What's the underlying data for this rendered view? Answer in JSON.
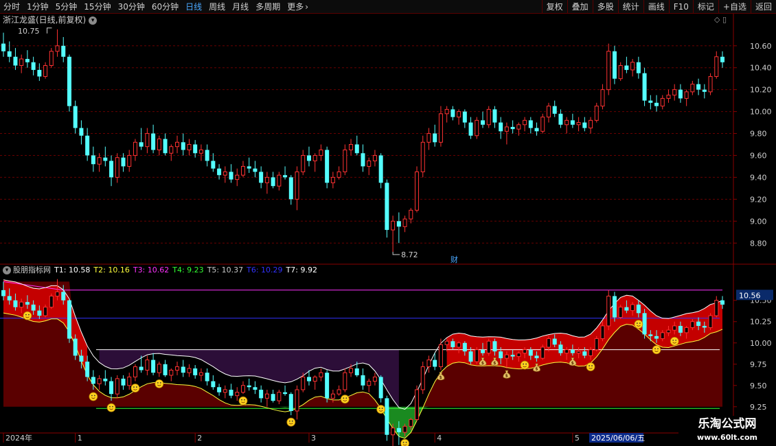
{
  "toolbar": {
    "timeframes": [
      "分时",
      "1分钟",
      "5分钟",
      "15分钟",
      "30分钟",
      "60分钟",
      "日线",
      "周线",
      "月线",
      "多周期",
      "更多"
    ],
    "active_timeframe": "日线",
    "tools": [
      "复权",
      "叠加",
      "多股",
      "统计",
      "画线",
      "F10",
      "标记",
      "+自选",
      "返回"
    ]
  },
  "colors": {
    "up": "#ff3232",
    "down": "#54ffff",
    "grid": "#6a0000",
    "axis": "#8a0000",
    "t1": "#ffffff",
    "t2": "#ffff3c",
    "t3": "#ff32ff",
    "t4": "#32ff32",
    "t5": "#c8c8c8",
    "t6": "#3232ff",
    "t7": "#ffffff",
    "red_band": "#c40000",
    "dark_band": "#5a0000",
    "purple_band": "#2c0e38",
    "green_band": "#1a8a20"
  },
  "main_chart": {
    "title": "浙江龙盛(日线,前复权)",
    "high_label": "10.75",
    "low_label": "8.72",
    "marker": "财"
  },
  "indicator": {
    "name": "股朋指标网",
    "values": [
      {
        "label": "T1:",
        "value": "10.58"
      },
      {
        "label": "T2:",
        "value": "10.16"
      },
      {
        "label": "T3:",
        "value": "10.62"
      },
      {
        "label": "T4:",
        "value": "9.23"
      },
      {
        "label": "T5:",
        "value": "10.37"
      },
      {
        "label": "T6:",
        "value": "10.29"
      },
      {
        "label": "T7:",
        "value": "9.92"
      }
    ],
    "current_value": "10.56",
    "emoji_markers": "smiley",
    "bag_markers": "money-bag"
  },
  "x_axis": {
    "labels": [
      {
        "text": "2024年",
        "i": 0
      },
      {
        "text": "1",
        "i": 12
      },
      {
        "text": "2",
        "i": 32
      },
      {
        "text": "3",
        "i": 51
      },
      {
        "text": "4",
        "i": 72
      },
      {
        "text": "5",
        "i": 95
      },
      {
        "text": "6",
        "i": 115
      }
    ],
    "highlight_date": "2025/06/06/五"
  },
  "watermark": {
    "line1": "乐淘公式网",
    "line2": "www.60lt.com"
  },
  "chart_data": {
    "type": "candlestick",
    "y_main": {
      "ticks": [
        8.8,
        9.0,
        9.2,
        9.4,
        9.6,
        9.8,
        10.0,
        10.2,
        10.4,
        10.6
      ],
      "range": [
        8.62,
        10.78
      ]
    },
    "y_indicator": {
      "ticks": [
        9.25,
        9.5,
        9.75,
        10.0,
        10.25,
        10.5
      ],
      "range": [
        8.95,
        10.78
      ]
    },
    "ohlc": [
      [
        10.62,
        10.72,
        10.5,
        10.55
      ],
      [
        10.55,
        10.64,
        10.45,
        10.5
      ],
      [
        10.5,
        10.58,
        10.38,
        10.42
      ],
      [
        10.42,
        10.52,
        10.35,
        10.48
      ],
      [
        10.48,
        10.56,
        10.4,
        10.45
      ],
      [
        10.45,
        10.5,
        10.33,
        10.38
      ],
      [
        10.38,
        10.44,
        10.28,
        10.32
      ],
      [
        10.32,
        10.45,
        10.3,
        10.42
      ],
      [
        10.42,
        10.58,
        10.4,
        10.55
      ],
      [
        10.55,
        10.75,
        10.5,
        10.6
      ],
      [
        10.6,
        10.68,
        10.45,
        10.5
      ],
      [
        10.5,
        10.52,
        10.0,
        10.05
      ],
      [
        10.05,
        10.1,
        9.8,
        9.85
      ],
      [
        9.85,
        9.92,
        9.7,
        9.78
      ],
      [
        9.78,
        9.85,
        9.55,
        9.6
      ],
      [
        9.6,
        9.68,
        9.45,
        9.52
      ],
      [
        9.52,
        9.62,
        9.45,
        9.58
      ],
      [
        9.58,
        9.68,
        9.5,
        9.55
      ],
      [
        9.55,
        9.6,
        9.32,
        9.4
      ],
      [
        9.4,
        9.62,
        9.35,
        9.58
      ],
      [
        9.58,
        9.62,
        9.45,
        9.5
      ],
      [
        9.5,
        9.65,
        9.45,
        9.6
      ],
      [
        9.6,
        9.75,
        9.55,
        9.72
      ],
      [
        9.72,
        9.85,
        9.65,
        9.68
      ],
      [
        9.68,
        9.85,
        9.62,
        9.8
      ],
      [
        9.8,
        9.88,
        9.62,
        9.65
      ],
      [
        9.65,
        9.78,
        9.6,
        9.75
      ],
      [
        9.75,
        9.8,
        9.6,
        9.62
      ],
      [
        9.62,
        9.7,
        9.55,
        9.68
      ],
      [
        9.68,
        9.78,
        9.62,
        9.72
      ],
      [
        9.72,
        9.8,
        9.6,
        9.65
      ],
      [
        9.65,
        9.75,
        9.6,
        9.7
      ],
      [
        9.7,
        9.74,
        9.58,
        9.62
      ],
      [
        9.62,
        9.7,
        9.55,
        9.65
      ],
      [
        9.65,
        9.7,
        9.5,
        9.55
      ],
      [
        9.55,
        9.62,
        9.45,
        9.48
      ],
      [
        9.48,
        9.52,
        9.38,
        9.42
      ],
      [
        9.42,
        9.5,
        9.35,
        9.45
      ],
      [
        9.45,
        9.52,
        9.35,
        9.38
      ],
      [
        9.38,
        9.48,
        9.32,
        9.42
      ],
      [
        9.42,
        9.55,
        9.4,
        9.5
      ],
      [
        9.5,
        9.58,
        9.44,
        9.48
      ],
      [
        9.48,
        9.55,
        9.4,
        9.45
      ],
      [
        9.45,
        9.5,
        9.3,
        9.35
      ],
      [
        9.35,
        9.45,
        9.25,
        9.4
      ],
      [
        9.4,
        9.45,
        9.3,
        9.32
      ],
      [
        9.32,
        9.45,
        9.28,
        9.42
      ],
      [
        9.42,
        9.5,
        9.38,
        9.4
      ],
      [
        9.4,
        9.42,
        9.15,
        9.2
      ],
      [
        9.2,
        9.5,
        9.1,
        9.45
      ],
      [
        9.45,
        9.65,
        9.42,
        9.6
      ],
      [
        9.6,
        9.68,
        9.5,
        9.55
      ],
      [
        9.55,
        9.62,
        9.45,
        9.6
      ],
      [
        9.6,
        9.7,
        9.55,
        9.65
      ],
      [
        9.65,
        9.68,
        9.3,
        9.35
      ],
      [
        9.35,
        9.45,
        9.3,
        9.4
      ],
      [
        9.4,
        9.5,
        9.38,
        9.45
      ],
      [
        9.45,
        9.7,
        9.42,
        9.65
      ],
      [
        9.65,
        9.75,
        9.6,
        9.7
      ],
      [
        9.7,
        9.78,
        9.6,
        9.62
      ],
      [
        9.62,
        9.7,
        9.45,
        9.5
      ],
      [
        9.5,
        9.58,
        9.42,
        9.55
      ],
      [
        9.55,
        9.65,
        9.5,
        9.6
      ],
      [
        9.6,
        9.62,
        9.3,
        9.35
      ],
      [
        9.35,
        9.38,
        8.85,
        8.92
      ],
      [
        8.92,
        9.05,
        8.72,
        9.0
      ],
      [
        9.0,
        9.08,
        8.8,
        8.95
      ],
      [
        8.95,
        9.05,
        8.9,
        9.02
      ],
      [
        9.02,
        9.12,
        8.98,
        9.1
      ],
      [
        9.1,
        9.5,
        9.08,
        9.45
      ],
      [
        9.45,
        9.78,
        9.4,
        9.72
      ],
      [
        9.72,
        9.85,
        9.65,
        9.8
      ],
      [
        9.8,
        9.88,
        9.68,
        9.72
      ],
      [
        9.72,
        10.05,
        9.68,
        9.98
      ],
      [
        9.98,
        10.05,
        9.9,
        10.02
      ],
      [
        10.02,
        10.05,
        9.92,
        9.95
      ],
      [
        9.95,
        10.02,
        9.88,
        10.0
      ],
      [
        10.0,
        10.02,
        9.85,
        9.9
      ],
      [
        9.9,
        9.95,
        9.75,
        9.78
      ],
      [
        9.78,
        9.95,
        9.75,
        9.92
      ],
      [
        9.92,
        10.0,
        9.85,
        9.88
      ],
      [
        9.88,
        10.05,
        9.85,
        10.02
      ],
      [
        10.02,
        10.05,
        9.85,
        9.9
      ],
      [
        9.9,
        9.95,
        9.75,
        9.82
      ],
      [
        9.82,
        9.9,
        9.7,
        9.86
      ],
      [
        9.86,
        9.92,
        9.8,
        9.84
      ],
      [
        9.84,
        9.9,
        9.78,
        9.88
      ],
      [
        9.88,
        9.95,
        9.82,
        9.92
      ],
      [
        9.92,
        9.95,
        9.8,
        9.85
      ],
      [
        9.85,
        9.9,
        9.78,
        9.82
      ],
      [
        9.82,
        9.98,
        9.8,
        9.95
      ],
      [
        9.95,
        10.08,
        9.9,
        10.05
      ],
      [
        10.05,
        10.1,
        9.95,
        9.98
      ],
      [
        9.98,
        10.02,
        9.85,
        9.88
      ],
      [
        9.88,
        9.95,
        9.8,
        9.92
      ],
      [
        9.92,
        9.98,
        9.85,
        9.88
      ],
      [
        9.88,
        9.95,
        9.82,
        9.9
      ],
      [
        9.9,
        9.95,
        9.82,
        9.85
      ],
      [
        9.85,
        9.95,
        9.8,
        9.92
      ],
      [
        9.92,
        10.08,
        9.9,
        10.05
      ],
      [
        10.05,
        10.25,
        10.02,
        10.2
      ],
      [
        10.2,
        10.62,
        10.15,
        10.55
      ],
      [
        10.55,
        10.6,
        10.25,
        10.3
      ],
      [
        10.3,
        10.45,
        10.28,
        10.42
      ],
      [
        10.42,
        10.5,
        10.35,
        10.38
      ],
      [
        10.38,
        10.48,
        10.32,
        10.45
      ],
      [
        10.45,
        10.5,
        10.3,
        10.35
      ],
      [
        10.35,
        10.4,
        10.05,
        10.1
      ],
      [
        10.1,
        10.15,
        10.02,
        10.08
      ],
      [
        10.08,
        10.15,
        10.0,
        10.05
      ],
      [
        10.05,
        10.15,
        10.02,
        10.12
      ],
      [
        10.12,
        10.2,
        10.08,
        10.15
      ],
      [
        10.15,
        10.25,
        10.1,
        10.2
      ],
      [
        10.2,
        10.25,
        10.08,
        10.12
      ],
      [
        10.12,
        10.2,
        10.05,
        10.18
      ],
      [
        10.18,
        10.28,
        10.15,
        10.25
      ],
      [
        10.25,
        10.3,
        10.15,
        10.2
      ],
      [
        10.2,
        10.25,
        10.12,
        10.18
      ],
      [
        10.18,
        10.35,
        10.15,
        10.32
      ],
      [
        10.32,
        10.55,
        10.3,
        10.5
      ],
      [
        10.5,
        10.55,
        10.4,
        10.45
      ]
    ],
    "smileys": [
      4,
      15,
      18,
      22,
      26,
      40,
      48,
      57,
      63,
      67,
      87,
      98,
      106,
      109,
      112
    ],
    "bags": [
      73,
      80,
      82,
      84,
      89,
      95
    ]
  }
}
